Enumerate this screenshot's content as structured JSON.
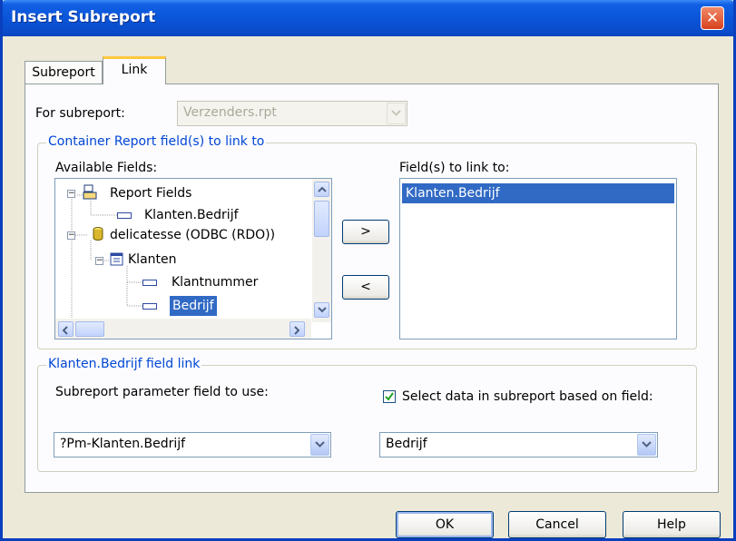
{
  "window": {
    "title": "Insert Subreport",
    "close_label": "✕"
  },
  "tabs": {
    "subreport": "Subreport",
    "link": "Link"
  },
  "for_subreport": {
    "label": "For subreport:",
    "value": "Verzenders.rpt"
  },
  "container": {
    "group_label": "Container Report field(s) to link to",
    "available_label": "Available Fields:",
    "link_to_label": "Field(s) to link to:",
    "tree": [
      {
        "label": "Report Fields"
      },
      {
        "label": "Klanten.Bedrijf"
      },
      {
        "label": "delicatesse (ODBC (RDO))"
      },
      {
        "label": "Klanten"
      },
      {
        "label": "Klantnummer"
      },
      {
        "label": "Bedrijf"
      }
    ],
    "linked_fields": [
      "Klanten.Bedrijf"
    ],
    "add_label": ">",
    "remove_label": "<"
  },
  "field_link": {
    "group_label": "Klanten.Bedrijf field link",
    "param_label": "Subreport parameter field to use:",
    "param_value": "?Pm-Klanten.Bedrijf",
    "select_label": "Select data in subreport based on field:",
    "select_checked": true,
    "select_value": "Bedrijf"
  },
  "buttons": {
    "ok": "OK",
    "cancel": "Cancel",
    "help": "Help"
  },
  "colors": {
    "accent": "#0a55d8",
    "selection": "#316ac5",
    "group_label": "#0046d5"
  }
}
